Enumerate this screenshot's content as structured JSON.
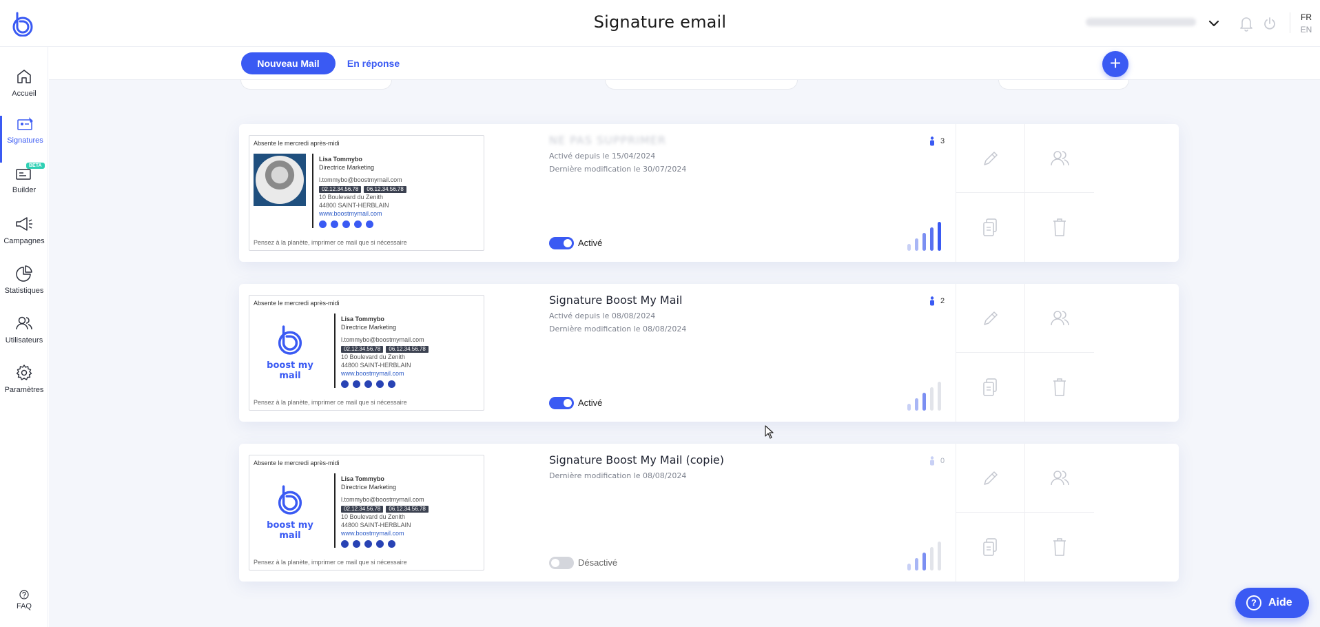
{
  "header": {
    "title": "Signature email",
    "lang_active": "FR",
    "lang_other": "EN"
  },
  "sidebar": {
    "items": [
      {
        "label": "Accueil",
        "icon": "home-icon"
      },
      {
        "label": "Signatures",
        "icon": "signature-icon",
        "active": true
      },
      {
        "label": "Builder",
        "icon": "builder-icon",
        "badge": "BETA"
      },
      {
        "label": "Campagnes",
        "icon": "megaphone-icon"
      },
      {
        "label": "Statistiques",
        "icon": "pie-chart-icon"
      },
      {
        "label": "Utilisateurs",
        "icon": "users-icon"
      },
      {
        "label": "Paramètres",
        "icon": "gear-icon"
      }
    ],
    "faq_label": "FAQ"
  },
  "tabs": {
    "new_mail": "Nouveau Mail",
    "reply": "En réponse"
  },
  "add_button": "+",
  "preview_common": {
    "top_text": "Absente le mercredi après-midi",
    "bottom_text": "Pensez à la planète, imprimer ce mail que si nécessaire",
    "name": "Lisa Tommybo",
    "role": "Directrice Marketing",
    "email": "l.tommybo@boostmymail.com",
    "phone1": "02.12.34.56.78",
    "phone2": "06.12.34.56.78",
    "address1": "10 Boulevard du Zenith",
    "address2": "44800 SAINT-HERBLAIN",
    "website": "www.boostmymail.com",
    "logo_text": "boost my mail"
  },
  "cards": [
    {
      "title": "NE PAS SUPPRIMER",
      "title_blurred": true,
      "active_since": "Activé depuis le 15/04/2024",
      "last_modified": "Dernière modification le 30/07/2024",
      "users": "3",
      "toggle_label": "Activé",
      "enabled": true,
      "bar_level": 5
    },
    {
      "title": "Signature Boost My Mail",
      "active_since": "Activé depuis le 08/08/2024",
      "last_modified": "Dernière modification le 08/08/2024",
      "users": "2",
      "toggle_label": "Activé",
      "enabled": true,
      "bar_level": 3
    },
    {
      "title": "Signature Boost My Mail (copie)",
      "last_modified": "Dernière modification le 08/08/2024",
      "users": "0",
      "toggle_label": "Désactivé",
      "enabled": false,
      "bar_level": 3
    }
  ],
  "help": {
    "icon": "?",
    "label": "Aide"
  },
  "colors": {
    "accent": "#3a5af3",
    "background": "#f4f6fb"
  }
}
